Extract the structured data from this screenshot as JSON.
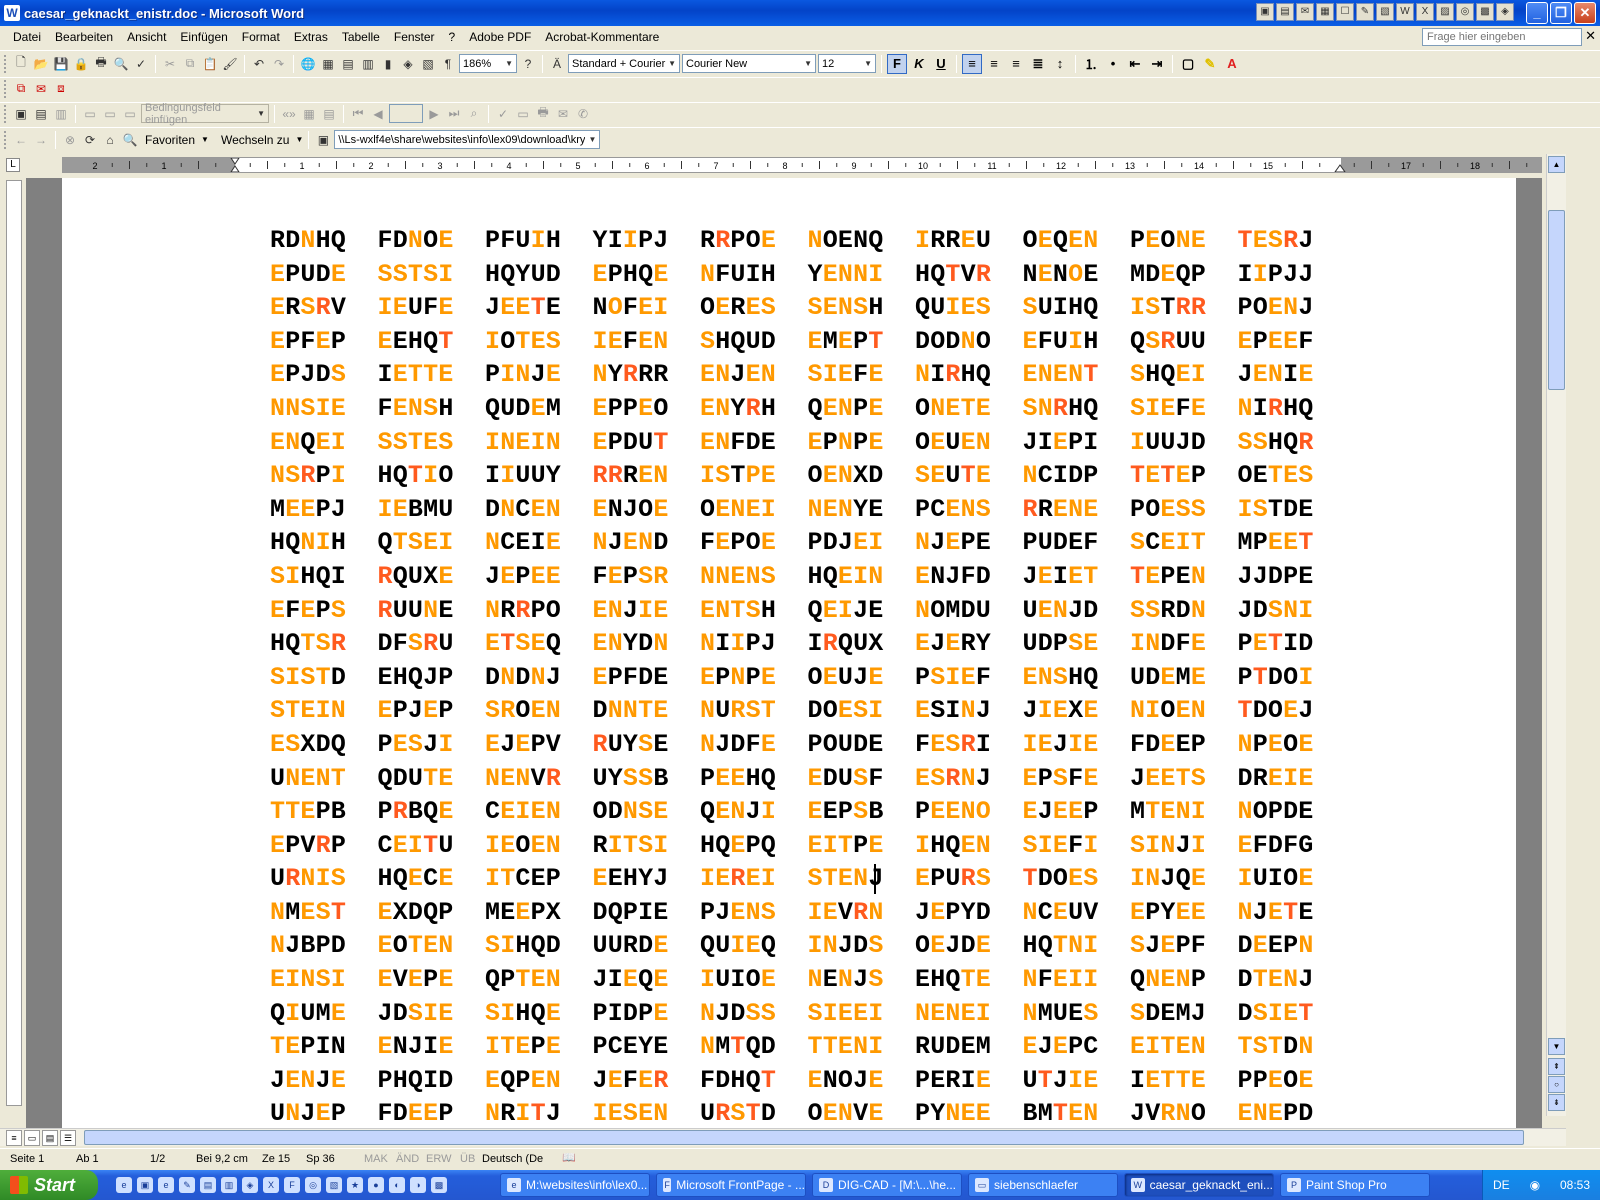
{
  "window": {
    "title": "caesar_geknackt_enistr.doc - Microsoft Word",
    "app_icon": "W"
  },
  "menu": [
    "Datei",
    "Bearbeiten",
    "Ansicht",
    "Einfügen",
    "Format",
    "Extras",
    "Tabelle",
    "Fenster",
    "?",
    "Adobe PDF",
    "Acrobat-Kommentare"
  ],
  "help_box_placeholder": "Frage hier eingeben",
  "toolbar": {
    "zoom": "186%",
    "style": "Standard + Courier",
    "font": "Courier New",
    "font_size": "12",
    "bold": "F",
    "italic": "K",
    "underline": "U",
    "mailmerge_field": "Bedingungsfeld einfügen",
    "favorites": "Favoriten",
    "goto": "Wechseln zu",
    "address": "\\\\Ls-wxlf4e\\share\\websites\\info\\lex09\\download\\kry"
  },
  "ruler_numbers": [
    "2",
    "1",
    "",
    "1",
    "2",
    "3",
    "4",
    "5",
    "6",
    "7",
    "8",
    "9",
    "10",
    "11",
    "12",
    "13",
    "14",
    "15",
    "",
    "17",
    "18"
  ],
  "colors": {
    "orange": "#ff9900",
    "red_orange": "#ff5a1e",
    "black": "#000000"
  },
  "document": {
    "rows": [
      "RD[1N]HQ FD[1N]O[1E] PFU[1I]H YI[1I]PJ R[2R]PO[1E] [1N]OENQ [1I]RR[1E]U O[1E]Q[1EN] P[1E]O[1NE] [2T][1ES][2R]J",
      "[1E]PUD[1E] [1SSTSI] HQYUD [1E]PHQ[1E] [1N]FUIH Y[1ENNI] HQ[2T]V[2R] N[1E]N[1O]E MD[1E]QP I[1I]PJJ",
      "[1E]R[1S][2R]V [1IE]UF[1E] J[1EE][2T]E N[1O]F[1EI] O[1E]R[1ES] [1SENS]H QU[1IES] [1S]UIHQ [1IS]T[2R][2R] PO[1EN]J",
      "[1E]PF[1E]P [1E]EHQ[2T] [1I]O[1TES] [1IE]F[1EN] [1S]HQUD [1E]M[1E]P[2T] DOD[1N]O [1E]FU[1I]H Q[1S][2R]UU [1E]P[1EE]F",
      "[1E]PJD[1S] I[1ETTE] P[1IN]J[1E] [1N]Y[2R]RR [1EN]J[1EN] [1SIE]F[1E] [1N]I[2R]HQ [1ENEN][2T] [1S]HQ[1EI] J[1EN]I[1E]",
      "[1NNSIE] F[1ENS]H QUD[1E]M [1E]PP[1E]O [1EN]Y[2R]H Q[1EN]P[1E] O[1NETE] [1SN][2R]HQ [1SIE]F[1E] [1N]I[2R]HQ",
      "[1EN]Q[1EI] [1SSTES] [1INEIN] [1E]PDU[2T] [1EN]FDE [1E]P[1N]P[1E] O[1E]U[1EN] JI[1E]PI [1I]UUJD [1SS]HQ[2R]",
      "[1NS][2R]P[1I] HQ[2T][1I]O I[1I]UUY [2R][2R]R[1EN] [1IS]T[1PE] O[1EN]XD [1SE]U[2T][1E] [1N]CIDP [2T][1E][2T][1E]P OE[1TES]",
      "M[1EE]PJ [1IE]BMU D[1N]C[1EN] [1E]NJO[1E] O[1ENEI] [1NEN]YE PC[1ENS] [2R]R[1ENE] PO[1E][1SS] [1IS]TDE",
      "HQ[1NI]H Q[1TSEI] [1N]CEI[1E] [1N]J[1EN]D F[1E]PO[1E] PDJ[1EI] [1N]J[1E]PE PUDEF [1S]C[1EIT] MP[1EE][2T]",
      "[1SI]HQI [2R]QUX[1E] J[1E]P[1EE] F[1E]P[1SR] [1NNENS] HQ[1EIN] [1E]NJFD J[1E]I[1ET] [2T][1E]PE[1N] JJDPE",
      "[1E]F[1E]P[1S] [2R]UU[1N]E [1N]R[2R]PO [1EN]J[1IE] [1ENTS]H Q[1EI]JE [1N]OMDU U[1EN]JD [1SS]RD[1N] JD[1SNI]",
      "HQ[1TS][2R] DF[1S][2R]U [1E][2T][1SE]Q [1EN]YD[1N] [1N]I[1I]PJ I[2R]QUX [1E]J[1E]RY UDP[1SE] [1IN]DF[1E] P[1E][2T]ID",
      "[1SIST]D EHQJP D[1N]D[1N]J [1E]PFDE [1E]P[1N]P[1E] O[1E]UJ[1E] P[1SIE]F [1ENS]HQ UD[1E]M[1E] P[2T]DO[1I]",
      "[1STEIN] [1E]PJ[1E]P [1SR]O[1EN] D[1NNTE] [1N]U[1RST] DO[1ESI] [1E]SI[1N]J J[1IE]X[1E] [1NI]O[1EN] [2T]DO[1E]J",
      "[1ES]XDQ P[1ES]J[1I] [1E]J[1E]PV [2R]UY[1S]E [1N]JDF[1E] POUDE F[1E][1S][2R]I [1IE]J[1IE] FD[1E]EP [1N]P[1E]O[1E]",
      "U[1NENT] QDU[1TE] [1NEN]V[2R] UY[1SS]B P[1EE]HQ [1E]DU[1S]F [1ES][2R][1N]J [1E]P[1S]F[1E] J[1EE][1TS] DR[1EI][1E]",
      "[1TTE]PB P[2R]BQ[1E] C[1EI][1E][1N] OD[1NSE] Q[1EN]J[1I] [1E]EP[1S]B P[1EENO] [1E]J[1EE]P M[1TENI] [1N]OPDE",
      "[1E]PV[2R]P C[1EI][2T]U [1IE]O[1EN] R[1ITSI] HQ[1E]PQ [1EIT]P[1E] [1I]HQ[1EN] [1SIE]F[1I] [1SIN]J[1I] [1E]FDFG",
      "U[2R][1NIS] HQ[1E]C[1E] [1IT]CEP [1E]EHYJ [1IE][2R][1EI] [1STEN]J [1E]PU[2R][1S] [2T]DO[1ES] [1IN]JQ[1E] [1I]UIO[1E]",
      "[1N]M[1ES][2T] [1E]XDQP ME[1E]PX DQPIE PJ[1ENS] [1IE]V[2R][1N] J[1E]PYD [1N]C[1E]UV [1E]PY[1EE] [1N]J[1E][2T]E",
      "[1N]JBPD [1E]O[1TEN] [1SI]HQD UURD[1E] QU[1IE]Q [1IN]JD[1S] O[1E]JD[1E] HQ[1TNI] [1S]J[1E]PF D[1E]EP[1N]",
      "[1EINSI] [1E]V[1E]P[1E] QP[1TEN] JI[1E]Q[1E] [1I]UIO[1E] [1N]E[1N]J[1S] EHQ[1TE] [1N]F[1EII] Q[1NEN]P D[1TEN]J",
      "Q[1I]UM[1E] JD[1SIE] [1SI]HQ[1E] PIDP[1E] [1N]JD[1SS] [1SIEEI] [1NENEI] [1N]MUE[1S] [1S]DEMJ D[1SIE][2T]",
      "[1TE]PIN [1E]NJI[1E] [1ITE]P[1E] PCEYE [1N]M[2T]QD [1TTENI] RUDEM [1E]J[1E]PC [1EITEN] [1TST]D[1N]",
      "J[1EN]J[1E] PHQID [1E]QP[1EN] J[1E]F[1E][2R] FDHQ[2T] [1E]NOJ[1E] PERI[1E] U[2T]J[1IE] I[1ETTE] PP[1E]O[1E]",
      "U[1N]J[1E]P FD[1EE]P [1N]R[1I][2T]J [1IESEN] U[2R][1S][2T]D O[1EN]V[1E] PY[1NEE] BM[2T][1EN] JV[1RN]O [1ENE]PD"
    ]
  },
  "status": {
    "page": "Seite 1",
    "section": "Ab 1",
    "pages": "1/2",
    "at": "Bei 9,2 cm",
    "line": "Ze 15",
    "col": "Sp 36",
    "mak": "MAK",
    "and": "ÄND",
    "erw": "ERW",
    "ub": "ÜB",
    "lang": "Deutsch (De"
  },
  "taskbar": {
    "start": "Start",
    "tasks": [
      "M:\\websites\\info\\lex0...",
      "Microsoft FrontPage - ...",
      "DIG-CAD - [M:\\...\\he...",
      "siebenschlaefer",
      "caesar_geknackt_eni...",
      "Paint Shop Pro"
    ],
    "lang": "DE",
    "clock": "08:53"
  }
}
